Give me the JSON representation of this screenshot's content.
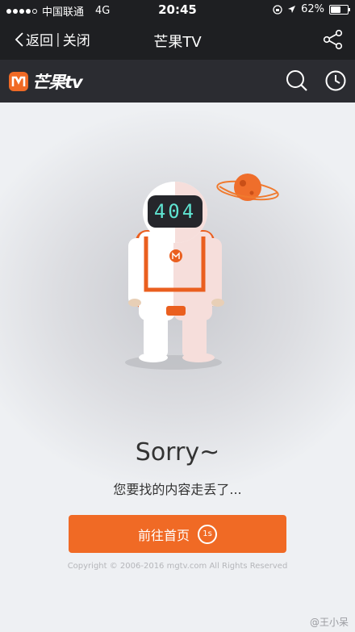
{
  "status_bar": {
    "carrier": "中国联通",
    "network": "4G",
    "time": "20:45",
    "battery": "62%",
    "battery_level": 0.62
  },
  "nav": {
    "back_label": "返回",
    "close_label": "关闭",
    "title": "芒果TV"
  },
  "header": {
    "logo_text": "芒果tv",
    "icons": [
      "search-icon",
      "history-clock-icon"
    ]
  },
  "error": {
    "code": "404",
    "title": "Sorry~",
    "message": "您要找的内容走丢了...",
    "button_label": "前往首页",
    "countdown": "1s"
  },
  "footer": {
    "copyright": "Copyright © 2006-2016 mgtv.com All Rights Reserved",
    "watermark": "@王小呆"
  },
  "colors": {
    "accent": "#f06a25",
    "bar": "#1e1f22",
    "header": "#2b2c31",
    "background": "#eef0f3"
  }
}
